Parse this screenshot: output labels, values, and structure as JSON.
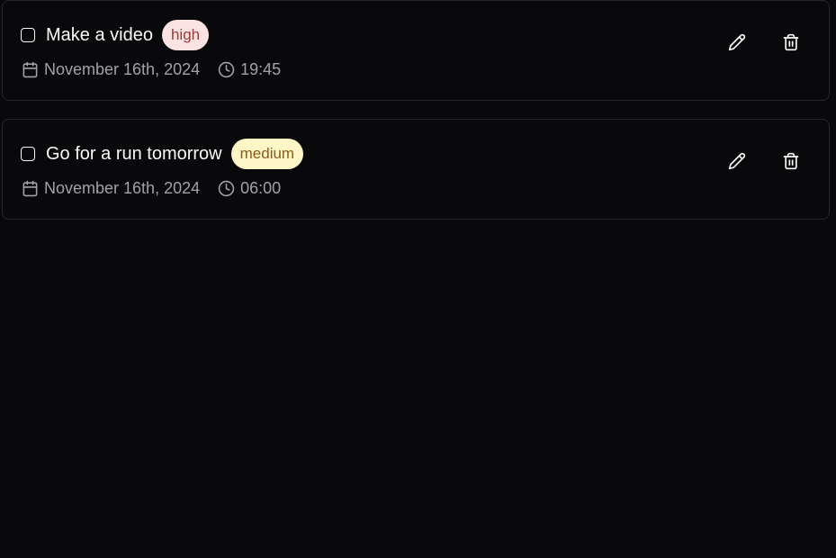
{
  "colors": {
    "background": "#09090b",
    "card_border": "#27272a",
    "text_primary": "#fafafa",
    "text_muted": "#a1a1aa"
  },
  "tasks": [
    {
      "title": "Make a video",
      "priority": "high",
      "priority_bg": "#fde2e2",
      "priority_fg": "#9b3b3b",
      "date": "November 16th, 2024",
      "time": "19:45",
      "completed": false,
      "icons": {
        "date": "calendar-icon",
        "time": "clock-icon",
        "edit": "pencil-icon",
        "delete": "trash-icon"
      }
    },
    {
      "title": "Go for a run tomorrow",
      "priority": "medium",
      "priority_bg": "#fef6c7",
      "priority_fg": "#8a5a1a",
      "date": "November 16th, 2024",
      "time": "06:00",
      "completed": false,
      "icons": {
        "date": "calendar-icon",
        "time": "clock-icon",
        "edit": "pencil-icon",
        "delete": "trash-icon"
      }
    }
  ]
}
